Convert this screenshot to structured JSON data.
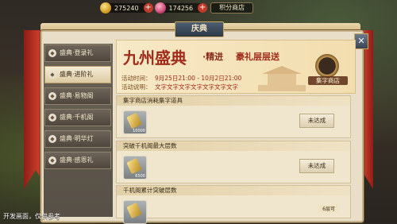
{
  "currencies": [
    {
      "icon": "gold-bar-icon",
      "value": "275240"
    },
    {
      "icon": "gem-icon",
      "value": "174256"
    }
  ],
  "shop_button": "积分商店",
  "title": "庆典",
  "menu": [
    {
      "label": "盛典·登录礼",
      "active": false
    },
    {
      "label": "盛典·进阶礼",
      "active": true
    },
    {
      "label": "盛典·易物阁",
      "active": false
    },
    {
      "label": "盛典·千机阁",
      "active": false
    },
    {
      "label": "盛典·明华灯",
      "active": false
    },
    {
      "label": "盛典·感恩礼",
      "active": false
    }
  ],
  "banner": {
    "logo": "九州盛典",
    "sub1": "·精进",
    "sub2": "豪礼层层送",
    "time_label": "活动时间：",
    "time_value": "9月25日21:00 - 10月2日21:00",
    "desc_label": "活动说明：",
    "desc_value": "文字文字文字文字文字文字文字"
  },
  "store_badge": "集字商店",
  "tasks": [
    {
      "title": "集字商店消耗集字道具",
      "item_count": "10000",
      "status": "未达成"
    },
    {
      "title": "突破千机阁最大层数",
      "item_count": "6500",
      "status": "未达成"
    },
    {
      "title": "千机阁累计突破层数",
      "item_count": "",
      "status": "",
      "progress": "6层可"
    }
  ],
  "footer_note": "开发画面，仅供参考",
  "colors": {
    "accent_red": "#a12c1b",
    "panel_bg": "#e9dfc8"
  }
}
